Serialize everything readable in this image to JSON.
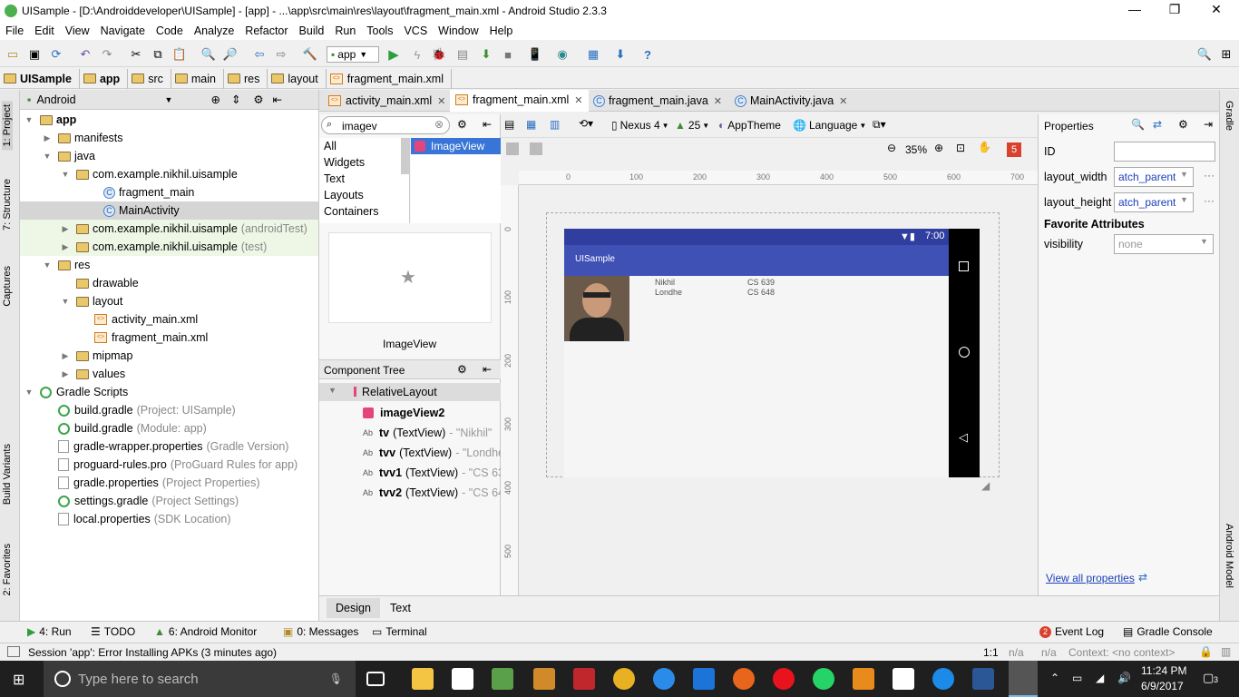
{
  "window": {
    "title": "UISample - [D:\\Androiddeveloper\\UISample] - [app] - ...\\app\\src\\main\\res\\layout\\fragment_main.xml - Android Studio 2.3.3"
  },
  "menu": [
    "File",
    "Edit",
    "View",
    "Navigate",
    "Code",
    "Analyze",
    "Refactor",
    "Build",
    "Run",
    "Tools",
    "VCS",
    "Window",
    "Help"
  ],
  "toolbar": {
    "run_config": "app"
  },
  "breadcrumb": [
    "UISample",
    "app",
    "src",
    "main",
    "res",
    "layout",
    "fragment_main.xml"
  ],
  "left_strip": {
    "project": "1: Project",
    "structure": "7: Structure",
    "captures": "Captures",
    "build_variants": "Build Variants",
    "favorites": "2: Favorites"
  },
  "right_strip": {
    "gradle": "Gradle",
    "android_model": "Android Model"
  },
  "project_panel": {
    "view_mode": "Android",
    "tree": [
      {
        "label": "app",
        "bold": true
      },
      {
        "label": "manifests"
      },
      {
        "label": "java"
      },
      {
        "label": "com.example.nikhil.uisample"
      },
      {
        "label": "fragment_main"
      },
      {
        "label": "MainActivity"
      },
      {
        "label": "com.example.nikhil.uisample",
        "suffix": "(androidTest)"
      },
      {
        "label": "com.example.nikhil.uisample",
        "suffix": "(test)"
      },
      {
        "label": "res"
      },
      {
        "label": "drawable"
      },
      {
        "label": "layout"
      },
      {
        "label": "activity_main.xml"
      },
      {
        "label": "fragment_main.xml"
      },
      {
        "label": "mipmap"
      },
      {
        "label": "values"
      },
      {
        "label": "Gradle Scripts"
      },
      {
        "label": "build.gradle",
        "suffix": "(Project: UISample)"
      },
      {
        "label": "build.gradle",
        "suffix": "(Module: app)"
      },
      {
        "label": "gradle-wrapper.properties",
        "suffix": "(Gradle Version)"
      },
      {
        "label": "proguard-rules.pro",
        "suffix": "(ProGuard Rules for app)"
      },
      {
        "label": "gradle.properties",
        "suffix": "(Project Properties)"
      },
      {
        "label": "settings.gradle",
        "suffix": "(Project Settings)"
      },
      {
        "label": "local.properties",
        "suffix": "(SDK Location)"
      }
    ]
  },
  "editor_tabs": [
    "activity_main.xml",
    "fragment_main.xml",
    "fragment_main.java",
    "MainActivity.java"
  ],
  "palette": {
    "search_value": "imagev",
    "categories": [
      "All",
      "Widgets",
      "Text",
      "Layouts",
      "Containers"
    ],
    "result": "ImageView",
    "preview_label": "ImageView"
  },
  "component_tree": {
    "title": "Component Tree",
    "root": "RelativeLayout",
    "items": [
      {
        "name": "imageView2",
        "type": "",
        "text": ""
      },
      {
        "name": "tv",
        "type": "(TextView)",
        "text": "- \"Nikhil\""
      },
      {
        "name": "tvv",
        "type": "(TextView)",
        "text": "- \"Londhe"
      },
      {
        "name": "tvv1",
        "type": "(TextView)",
        "text": "- \"CS 639"
      },
      {
        "name": "tvv2",
        "type": "(TextView)",
        "text": "- \"CS 648"
      }
    ]
  },
  "design_toolbar": {
    "device": "Nexus 4",
    "api": "25",
    "theme": "AppTheme",
    "language": "Language",
    "zoom": "35%",
    "warnings": "5"
  },
  "ruler": {
    "h": [
      "0",
      "100",
      "200",
      "300",
      "400",
      "500",
      "600",
      "700"
    ],
    "v": [
      "0",
      "100",
      "200",
      "300",
      "400",
      "500"
    ]
  },
  "device": {
    "time": "7:00",
    "app_title": "UISample",
    "name_first": "Nikhil",
    "name_last": "Londhe",
    "course1": "CS 639",
    "course2": "CS 648"
  },
  "properties": {
    "title": "Properties",
    "id_label": "ID",
    "id_value": "",
    "layout_width_label": "layout_width",
    "layout_width_value": "atch_parent",
    "layout_height_label": "layout_height",
    "layout_height_value": "atch_parent",
    "favorites_title": "Favorite Attributes",
    "visibility_label": "visibility",
    "visibility_value": "none",
    "view_all": "View all properties"
  },
  "bottom_tabs": [
    "Design",
    "Text"
  ],
  "tool_tabs": {
    "run": "4: Run",
    "todo": "TODO",
    "monitor": "6: Android Monitor",
    "messages": "0: Messages",
    "terminal": "Terminal",
    "event_log": "Event Log",
    "event_count": "2",
    "gradle_console": "Gradle Console"
  },
  "status": {
    "message": "Session 'app': Error Installing APKs (3 minutes ago)",
    "pos": "1:1",
    "na1": "n/a",
    "na2": "n/a",
    "context": "Context: <no context>"
  },
  "taskbar": {
    "search_placeholder": "Type here to search",
    "time": "11:24 PM",
    "date": "6/9/2017",
    "notif": "3"
  }
}
